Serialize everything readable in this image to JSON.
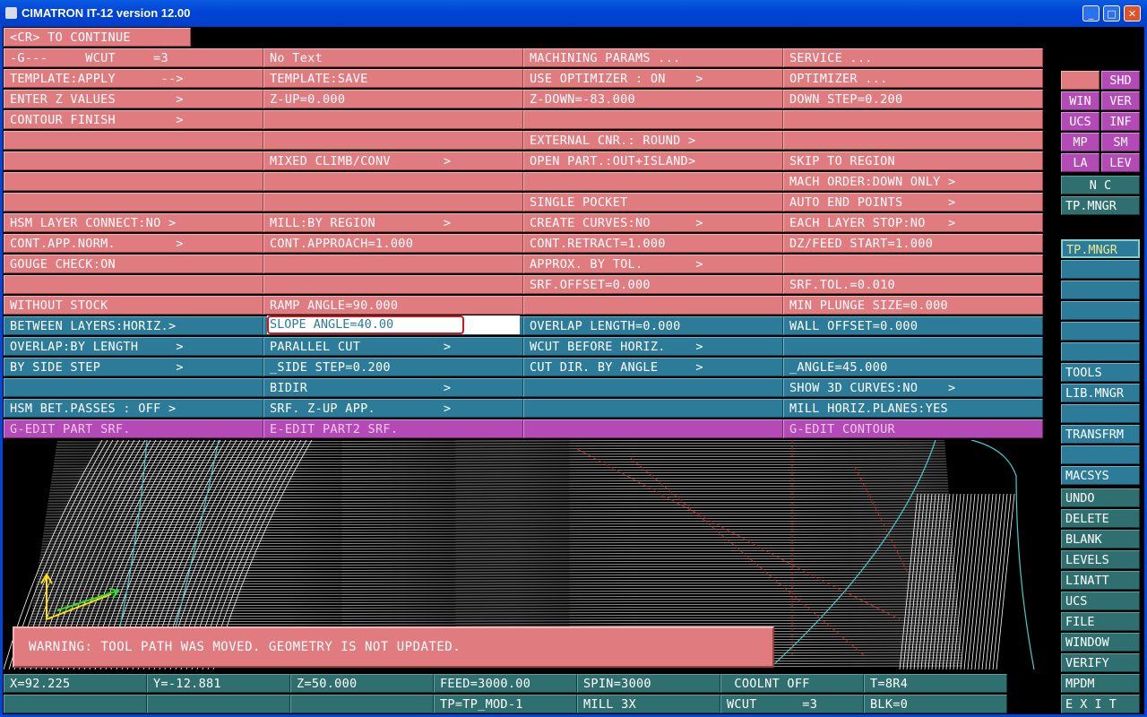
{
  "window": {
    "title": "CIMATRON IT-12 version 12.00",
    "minimize": "_",
    "maximize": "□",
    "close": "✕"
  },
  "prompt": "<CR> TO CONTINUE",
  "menu": [
    [
      "-G---     WCUT     =3",
      "No Text",
      "MACHINING PARAMS ...",
      "SERVICE ..."
    ],
    [
      "TEMPLATE:APPLY      -->",
      "TEMPLATE:SAVE",
      "USE OPTIMIZER : ON    >",
      "OPTIMIZER ..."
    ],
    [
      "ENTER Z VALUES        >",
      "Z-UP=0.000",
      "Z-DOWN=-83.000",
      "DOWN STEP=0.200"
    ],
    [
      "CONTOUR FINISH        >",
      "",
      "",
      ""
    ],
    [
      "",
      "",
      "EXTERNAL CNR.: ROUND >",
      ""
    ],
    [
      "",
      "MIXED CLIMB/CONV       >",
      "OPEN PART.:OUT+ISLAND>",
      "SKIP TO REGION"
    ],
    [
      "",
      "",
      "",
      "MACH ORDER:DOWN ONLY >"
    ],
    [
      "",
      "",
      "SINGLE POCKET",
      "AUTO END POINTS      >"
    ],
    [
      "HSM LAYER CONNECT:NO >",
      "MILL:BY REGION         >",
      "CREATE CURVES:NO      >",
      "EACH LAYER STOP:NO   >"
    ],
    [
      "CONT.APP.NORM.        >",
      "CONT.APPROACH=1.000",
      "CONT.RETRACT=1.000",
      "DZ/FEED START=1.000"
    ],
    [
      "GOUGE CHECK:ON",
      "",
      "APPROX. BY TOL.       >",
      ""
    ],
    [
      "",
      "",
      "SRF.OFFSET=0.000",
      "SRF.TOL.=0.010"
    ],
    [
      "WITHOUT STOCK",
      "RAMP ANGLE=90.000",
      "",
      "MIN PLUNGE SIZE=0.000"
    ],
    [
      "BETWEEN LAYERS:HORIZ.>",
      "SLOPE ANGLE=40.00",
      "OVERLAP LENGTH=0.000",
      "WALL OFFSET=0.000"
    ],
    [
      "OVERLAP:BY LENGTH     >",
      "PARALLEL CUT           >",
      "WCUT BEFORE HORIZ.    >",
      ""
    ],
    [
      "BY SIDE STEP          >",
      "_SIDE STEP=0.200",
      "CUT DIR. BY ANGLE     >",
      "_ANGLE=45.000"
    ],
    [
      "",
      "BIDIR                  >",
      "",
      "SHOW 3D CURVES:NO    >"
    ],
    [
      "HSM BET.PASSES : OFF >",
      "SRF. Z-UP APP.         >",
      "",
      "MILL HORIZ.PLANES:YES"
    ],
    [
      "G-EDIT PART SRF.",
      "E-EDIT PART2 SRF.",
      "",
      "G-EDIT CONTOUR"
    ]
  ],
  "slope_input": "SLOPE ANGLE=40.00",
  "warning": "WARNING: TOOL PATH WAS MOVED. GEOMETRY IS NOT UPDATED.",
  "status_row1": [
    "X=92.225",
    "Y=-12.881",
    "Z=50.000",
    "FEED=3000.00",
    "SPIN=3000",
    " COOLNT OFF",
    "T=8R4"
  ],
  "status_row2": [
    "",
    "",
    "",
    "TP=TP_MOD-1",
    "MILL 3X",
    "WCUT      =3",
    "BLK=0"
  ],
  "right_panel": {
    "top_pairs": [
      [
        "",
        "SHD"
      ],
      [
        "WIN",
        "VER"
      ],
      [
        "UCS",
        "INF"
      ],
      [
        "MP",
        "SM"
      ],
      [
        "LA",
        "LEV"
      ]
    ],
    "nc": "N C",
    "tp_mngr_1": "TP.MNGR",
    "tp_mngr_2": "TP.MNGR",
    "tools": "TOOLS",
    "lib_mngr": "LIB.MNGR",
    "transfrm": "TRANSFRM",
    "macsys": "MACSYS",
    "bottom": [
      "UNDO",
      "DELETE",
      "BLANK",
      "LEVELS",
      "LINATT",
      "UCS",
      "FILE",
      "WINDOW",
      "VERIFY",
      "MPDM",
      "E X I T"
    ]
  },
  "colors": {
    "menu_pink": "#e07c80",
    "menu_blue": "#2c7b99",
    "menu_magenta": "#b34ab5",
    "status_teal": "#2f6f6f",
    "titlebar": "#0046d8"
  }
}
